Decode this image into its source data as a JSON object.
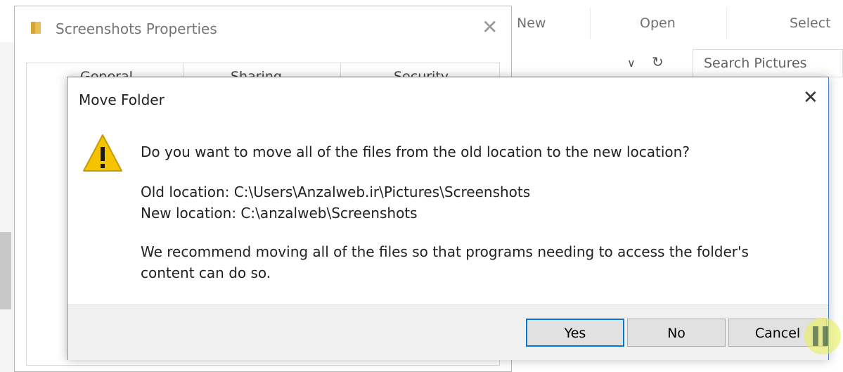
{
  "explorer": {
    "ribbon": {
      "new_label": "New",
      "open_label": "Open",
      "select_label": "Select"
    },
    "search": {
      "placeholder": "Search Pictures"
    }
  },
  "properties": {
    "title": "Screenshots Properties",
    "tabs": [
      "General",
      "Sharing",
      "Security"
    ]
  },
  "dialog": {
    "title": "Move Folder",
    "question": "Do you want to move all of the files from the old location to the new location?",
    "old_location": "Old location: C:\\Users\\Anzalweb.ir\\Pictures\\Screenshots",
    "new_location": "New location: C:\\anzalweb\\Screenshots",
    "recommendation": "We recommend moving all of the files so that programs needing to access the folder's content can do so.",
    "buttons": {
      "yes": "Yes",
      "no": "No",
      "cancel": "Cancel"
    }
  },
  "icons": {
    "warning": "warning-icon",
    "close": "close-icon",
    "folder": "folder-icon",
    "refresh": "refresh-icon",
    "chevron": "chevron-down-icon"
  },
  "colors": {
    "accent": "#0078d7",
    "warning": "#f4c400"
  }
}
